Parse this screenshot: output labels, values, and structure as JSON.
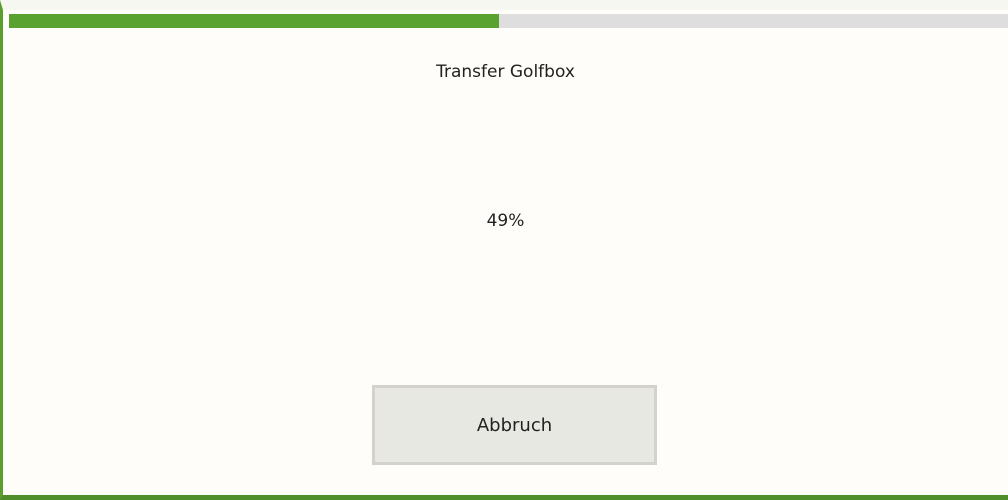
{
  "dialog": {
    "title": "Transfer Golfbox",
    "percent_text": "49%",
    "progress_fraction": 0.49,
    "cancel_label": "Abbruch"
  },
  "colors": {
    "progress_fill": "#59a22f",
    "progress_track": "#dedede",
    "border_green": "#5a9e2f",
    "background": "#fefdf9",
    "button_bg": "#e8e8e3"
  }
}
